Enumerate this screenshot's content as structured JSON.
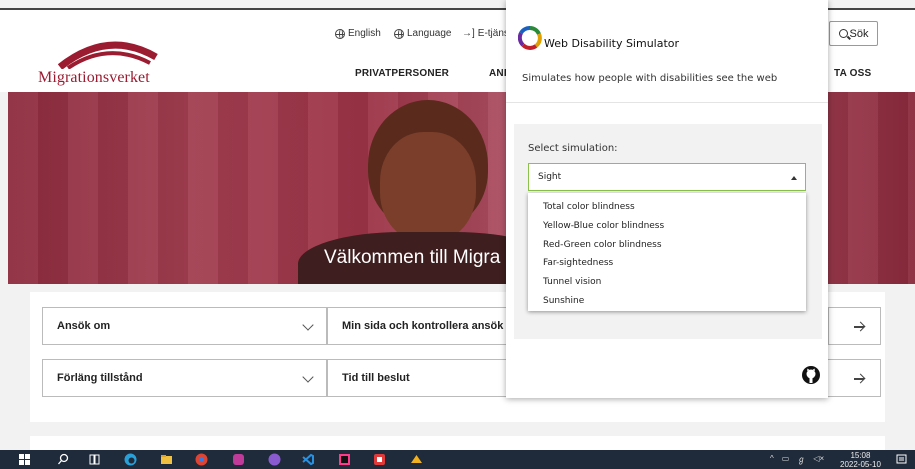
{
  "site": {
    "logo_text": "Migrationsverket",
    "top_links": [
      "English",
      "Language",
      "E-tjäns"
    ],
    "nav": [
      "PRIVATPERSONER",
      "AND",
      "TA OSS"
    ],
    "search_label": "Sök",
    "hero_title": "Välkommen till Migra"
  },
  "cards": [
    {
      "label": "Ansök om"
    },
    {
      "label": "Min sida och kontrollera ansök"
    },
    {
      "label": "Förläng tillstånd"
    },
    {
      "label": "Tid till beslut"
    }
  ],
  "popup": {
    "title": "Web Disability Simulator",
    "subtitle": "Simulates how people with disabilities see the web",
    "select_label": "Select simulation:",
    "selected": "Sight",
    "options": [
      "Total color blindness",
      "Yellow-Blue color blindness",
      "Red-Green color blindness",
      "Far-sightedness",
      "Tunnel vision",
      "Sunshine"
    ],
    "github_icon": "github-icon"
  },
  "taskbar": {
    "time": "15:08",
    "date": "2022-05-10"
  },
  "colors": {
    "brand": "#9b1b30",
    "select_border": "#8ac24a",
    "taskbar": "#1f2a3a"
  }
}
